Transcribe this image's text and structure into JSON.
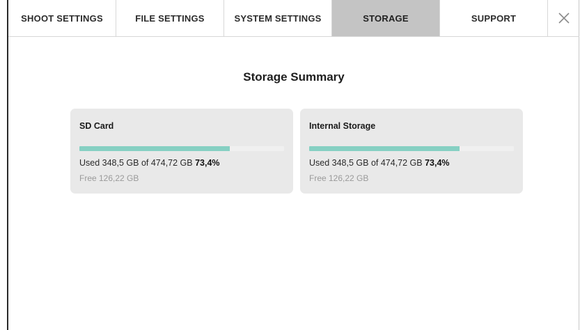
{
  "tabs": [
    {
      "label": "SHOOT SETTINGS"
    },
    {
      "label": "FILE SETTINGS"
    },
    {
      "label": "SYSTEM SETTINGS"
    },
    {
      "label": "STORAGE",
      "active": true
    },
    {
      "label": "SUPPORT"
    }
  ],
  "close_icon": "close-icon",
  "title": "Storage Summary",
  "storage": [
    {
      "name": "SD Card",
      "used_text": "Used 348,5 GB of 474,72 GB",
      "percent_text": "73,4%",
      "percent": 73.4,
      "free_text": "Free 126,22 GB"
    },
    {
      "name": "Internal Storage",
      "used_text": "Used 348,5 GB of 474,72 GB",
      "percent_text": "73,4%",
      "percent": 73.4,
      "free_text": "Free 126,22 GB"
    }
  ],
  "colors": {
    "active_tab": "#c4c4c4",
    "card_bg": "#e9e9e9",
    "bar_fill": "#86d0c3",
    "free_text": "#9a9a9a"
  }
}
